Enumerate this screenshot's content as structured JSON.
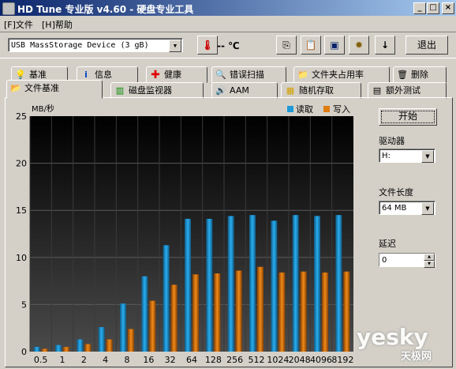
{
  "window": {
    "title": "HD Tune 专业版 v4.60 - 硬盘专业工具"
  },
  "menu": [
    {
      "label": "[F]文件"
    },
    {
      "label": "[H]帮助"
    }
  ],
  "toolbar": {
    "drive": "USB MassStorage Device    (3 gB)",
    "temperature": "-- ℃",
    "exit_label": "退出"
  },
  "tabs_row1": [
    {
      "label": "基准",
      "icon": "lightbulb-icon"
    },
    {
      "label": "信息",
      "icon": "info-icon"
    },
    {
      "label": "健康",
      "icon": "health-cross-icon"
    },
    {
      "label": "错误扫描",
      "icon": "magnifier-icon"
    },
    {
      "label": "文件夹占用率",
      "icon": "folder-icon"
    },
    {
      "label": "删除",
      "icon": "trash-icon"
    }
  ],
  "tabs_row2": [
    {
      "label": "文件基准",
      "icon": "file-benchmark-icon",
      "active": true
    },
    {
      "label": "磁盘监视器",
      "icon": "monitor-chart-icon"
    },
    {
      "label": "AAM",
      "icon": "speaker-icon"
    },
    {
      "label": "随机存取",
      "icon": "random-access-icon"
    },
    {
      "label": "额外测试",
      "icon": "extra-tests-icon"
    }
  ],
  "controls": {
    "start_label": "开始",
    "drive_label": "驱动器",
    "drive_value": "H:",
    "file_length_label": "文件长度",
    "file_length_value": "64 MB",
    "delay_label": "延迟",
    "delay_value": "0"
  },
  "watermark": {
    "main": "yesky",
    "sub": "天极网"
  },
  "chart_data": {
    "type": "bar",
    "ylabel": "MB/秒",
    "ylim": [
      0,
      25
    ],
    "yticks": [
      0,
      5,
      10,
      15,
      20,
      25
    ],
    "categories": [
      "0.5",
      "1",
      "2",
      "4",
      "8",
      "16",
      "32",
      "64",
      "128",
      "256",
      "512",
      "1024",
      "2048",
      "4096",
      "8192"
    ],
    "series": [
      {
        "name": "读取",
        "color": "#1e9ad6",
        "values": [
          0.5,
          0.7,
          1.3,
          2.6,
          5.1,
          8.0,
          11.3,
          14.1,
          14.1,
          14.4,
          14.5,
          13.9,
          14.5,
          14.4,
          14.5
        ]
      },
      {
        "name": "写入",
        "color": "#e07b10",
        "values": [
          0.3,
          0.5,
          0.8,
          1.3,
          2.4,
          5.4,
          7.1,
          8.2,
          8.3,
          8.6,
          9.0,
          8.4,
          8.5,
          8.4,
          8.5
        ]
      }
    ],
    "legend": "top-right",
    "grid": true
  }
}
